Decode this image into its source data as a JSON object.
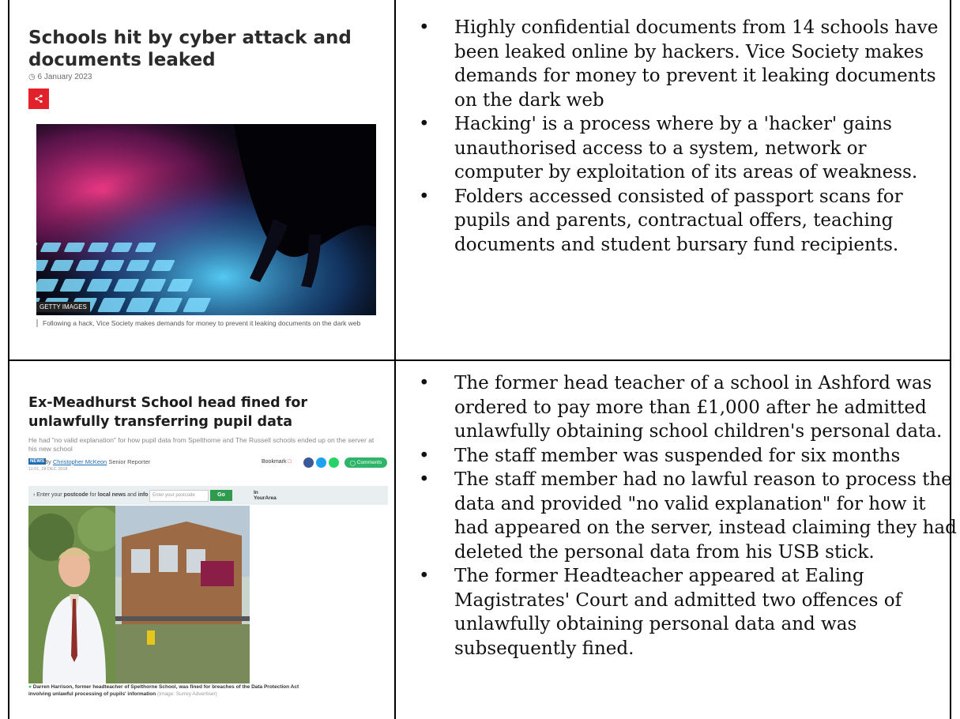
{
  "row1": {
    "article": {
      "headline": "Schools hit by cyber attack and documents leaked",
      "date": "6 January 2023",
      "share_icon": "share-icon",
      "photo_credit": "GETTY IMAGES",
      "caption": "Following a hack, Vice Society makes demands for money to prevent it leaking documents on the dark web"
    },
    "bullets": [
      "Highly confidential documents from 14 schools have been leaked online by hackers. Vice Society makes demands for money to prevent it leaking documents on the dark web",
      "Hacking' is a process where by a 'hacker' gains unauthorised access to a system, network or computer by exploitation of its areas of weakness.",
      "Folders accessed consisted of passport scans for pupils and parents, contractual offers, teaching documents and student bursary fund recipients."
    ]
  },
  "row2": {
    "article": {
      "headline": "Ex-Meadhurst School head fined for unlawfully transferring pupil data",
      "standfirst": "He had \"no valid explanation\" for how pupil data from Spelthorne and The Russell schools ended up on the server at his new school",
      "tag": "NEWS",
      "by": "By",
      "author": "Christopher McKeon",
      "role": "Senior Reporter",
      "published": "11:01, 28 DEC 2018",
      "bookmark": "Bookmark",
      "comments": "Comments",
      "postcode_prefix": "Enter your",
      "postcode_word": "postcode",
      "postcode_mid": "for",
      "postcode_news": "local news",
      "postcode_and": "and",
      "postcode_info": "info",
      "postcode_placeholder": "Enter your postcode",
      "go": "Go",
      "brand_line1": "In",
      "brand_line2": "YourArea",
      "caption": "Darren Harrison, former headteacher of Spelthorne School, was fined for breaches of the Data Protection Act involving unlawful processing of pupils' information",
      "caption_credit": "(Image: Surrey Advertiser)"
    },
    "bullets": [
      "The former head teacher of a school in Ashford was ordered to pay more than £1,000 after he admitted unlawfully obtaining school children's personal data.",
      "The staff member was suspended for six months",
      "The staff member had no lawful reason to process the data and provided \"no valid explanation\" for how it had appeared on the server, instead claiming they had deleted the personal data from his USB stick.",
      "The former Headteacher appeared at Ealing Magistrates' Court and admitted two offences of unlawfully obtaining personal data and was subsequently fined."
    ]
  }
}
